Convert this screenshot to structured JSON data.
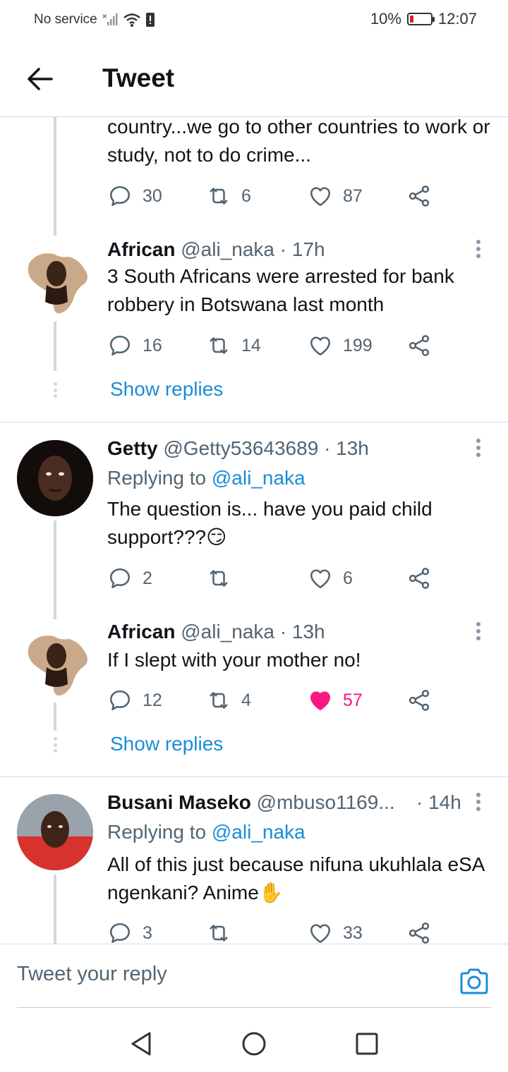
{
  "status_bar": {
    "carrier": "No service",
    "battery_percent": "10%",
    "time": "12:07",
    "battery_level": 0.1,
    "battery_color": "#e02020"
  },
  "header": {
    "title": "Tweet",
    "back_icon": "arrow-left-icon"
  },
  "accent_color": "#1a8cd8",
  "like_color": "#f91880",
  "tweets": [
    {
      "text": "country...we go to other countries to work or study, not to do crime...",
      "reply_count": "30",
      "retweet_count": "6",
      "like_count": "87"
    },
    {
      "name": "African",
      "handle": "@ali_naka",
      "time": "· 17h",
      "text": "3 South Africans were arrested for bank robbery in Botswana last month",
      "reply_count": "16",
      "retweet_count": "14",
      "like_count": "199",
      "show_replies": "Show replies"
    },
    {
      "name": "Getty",
      "handle": "@Getty53643689",
      "time": "· 13h",
      "replying_prefix": "Replying to",
      "replying_to": "@ali_naka",
      "text": "The question is... have you paid child support???😏",
      "reply_count": "2",
      "retweet_count": "",
      "like_count": "6"
    },
    {
      "name": "African",
      "handle": "@ali_naka",
      "time": "· 13h",
      "text": "If I slept with your mother no!",
      "reply_count": "12",
      "retweet_count": "4",
      "like_count": "57",
      "liked": true,
      "show_replies": "Show replies"
    },
    {
      "name": "Busani Maseko",
      "handle": "@mbuso1169...",
      "time": "· 14h",
      "replying_prefix": "Replying to",
      "replying_to": "@ali_naka",
      "text": "All of this just because nifuna ukuhlala eSA ngenkani? Anime✋",
      "reply_count": "3",
      "retweet_count": "",
      "like_count": "33"
    }
  ],
  "reply_bar": {
    "placeholder": "Tweet your reply",
    "camera_icon": "camera-icon"
  },
  "nav_bar": {
    "back_icon": "triangle-back-icon",
    "home_icon": "circle-home-icon",
    "recents_icon": "square-recents-icon"
  }
}
